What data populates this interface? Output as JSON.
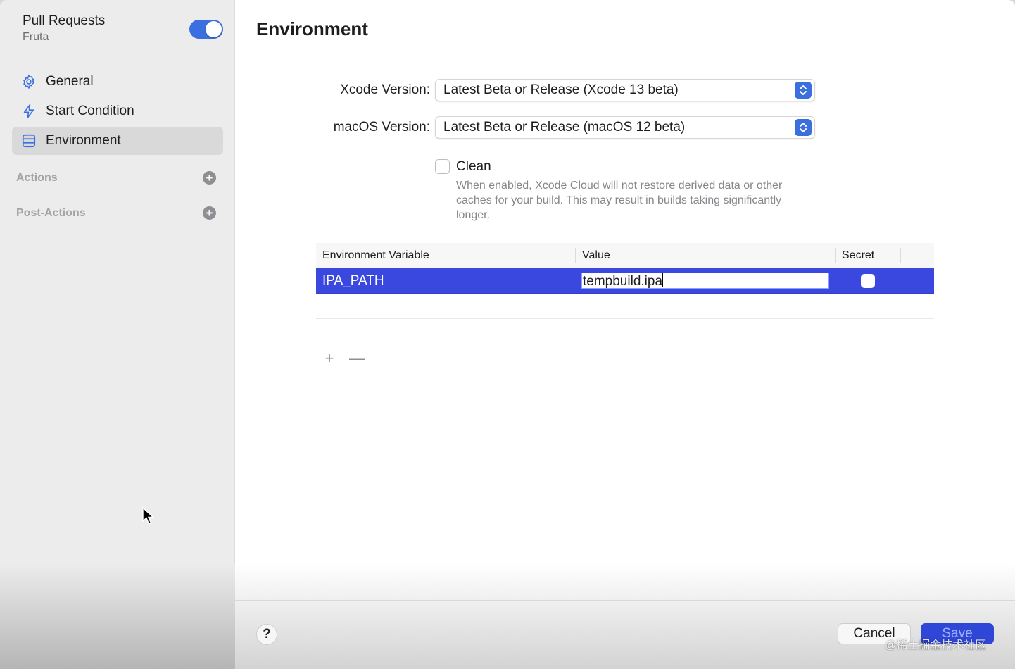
{
  "sidebar": {
    "workflow_title": "Pull Requests",
    "workflow_subtitle": "Fruta",
    "toggle_on": true,
    "items": [
      {
        "label": "General",
        "icon": "gear-icon"
      },
      {
        "label": "Start Condition",
        "icon": "bolt-icon"
      },
      {
        "label": "Environment",
        "icon": "environment-icon",
        "selected": true
      }
    ],
    "sections": [
      {
        "label": "Actions"
      },
      {
        "label": "Post-Actions"
      }
    ]
  },
  "main": {
    "title": "Environment",
    "xcode": {
      "label": "Xcode Version:",
      "value": "Latest Beta or Release (Xcode 13 beta)"
    },
    "macos": {
      "label": "macOS Version:",
      "value": "Latest Beta or Release (macOS 12 beta)"
    },
    "clean": {
      "label": "Clean",
      "checked": false,
      "description": "When enabled, Xcode Cloud will not restore derived data or other caches for your build. This may result in builds taking significantly longer."
    },
    "table": {
      "headers": [
        "Environment Variable",
        "Value",
        "Secret"
      ],
      "rows": [
        {
          "name": "IPA_PATH",
          "value": "tempbuild.ipa",
          "secret": false,
          "selected": true
        }
      ]
    },
    "tools": {
      "add": "+",
      "remove": "—"
    }
  },
  "footer": {
    "help": "?",
    "cancel": "Cancel",
    "save": "Save",
    "watermark": "@稀土掘金技术社区"
  },
  "colors": {
    "accent": "#3b6fe0",
    "selection": "#3b48e0"
  }
}
